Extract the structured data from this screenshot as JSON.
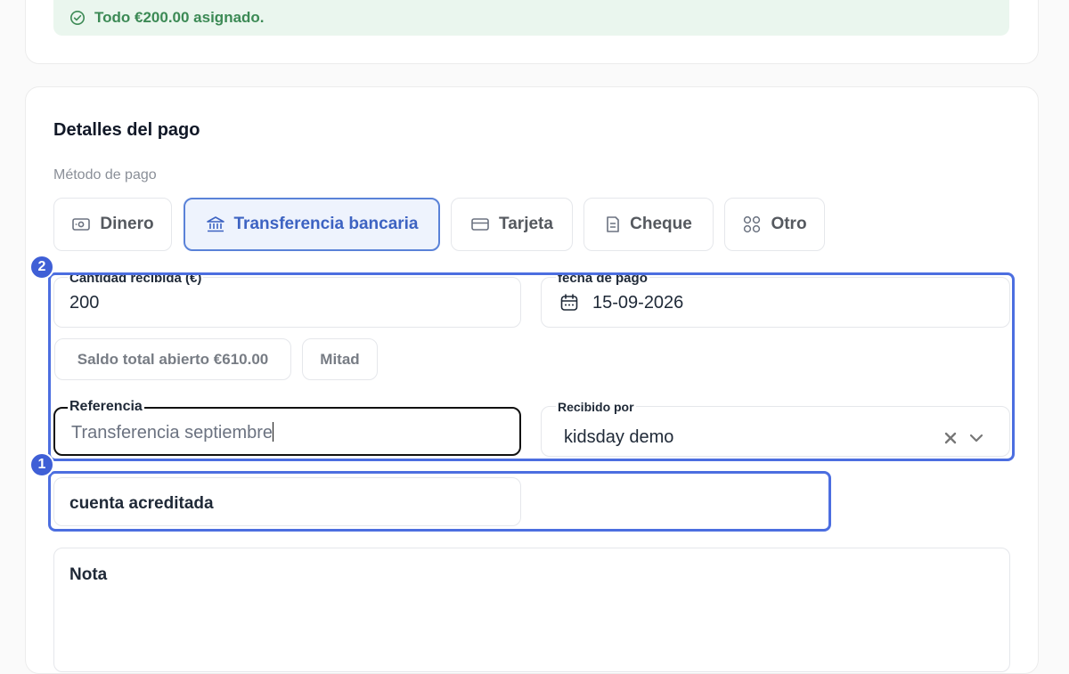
{
  "banner": {
    "text": "Todo €200.00 asignado."
  },
  "payment": {
    "title": "Detalles del pago",
    "method_label": "Método de pago",
    "methods": [
      {
        "label": "Dinero",
        "icon": "cash-icon",
        "active": false
      },
      {
        "label": "Transferencia bancaria",
        "icon": "bank-icon",
        "active": true
      },
      {
        "label": "Tarjeta",
        "icon": "card-icon",
        "active": false
      },
      {
        "label": "Cheque",
        "icon": "check-icon",
        "active": false
      },
      {
        "label": "Otro",
        "icon": "grid-icon",
        "active": false
      }
    ],
    "amount": {
      "label": "Cantidad recibida (€)",
      "value": "200"
    },
    "date": {
      "label": "fecha de pago",
      "value": "15-09-2026"
    },
    "quick_amounts": [
      "Saldo total abierto €610.00",
      "Mitad"
    ],
    "reference": {
      "label": "Referencia",
      "value": "Transferencia septiembre"
    },
    "received_by": {
      "label": "Recibido por",
      "value": "kidsday demo"
    },
    "credited_account": {
      "label": "cuenta acreditada"
    },
    "note": {
      "label": "Nota"
    }
  },
  "annotations": [
    "1",
    "2"
  ],
  "colors": {
    "accent": "#3f5fd6",
    "success_bg": "#eaf6ee",
    "success_text": "#3c8a55",
    "active_method": "#3d63c2"
  }
}
